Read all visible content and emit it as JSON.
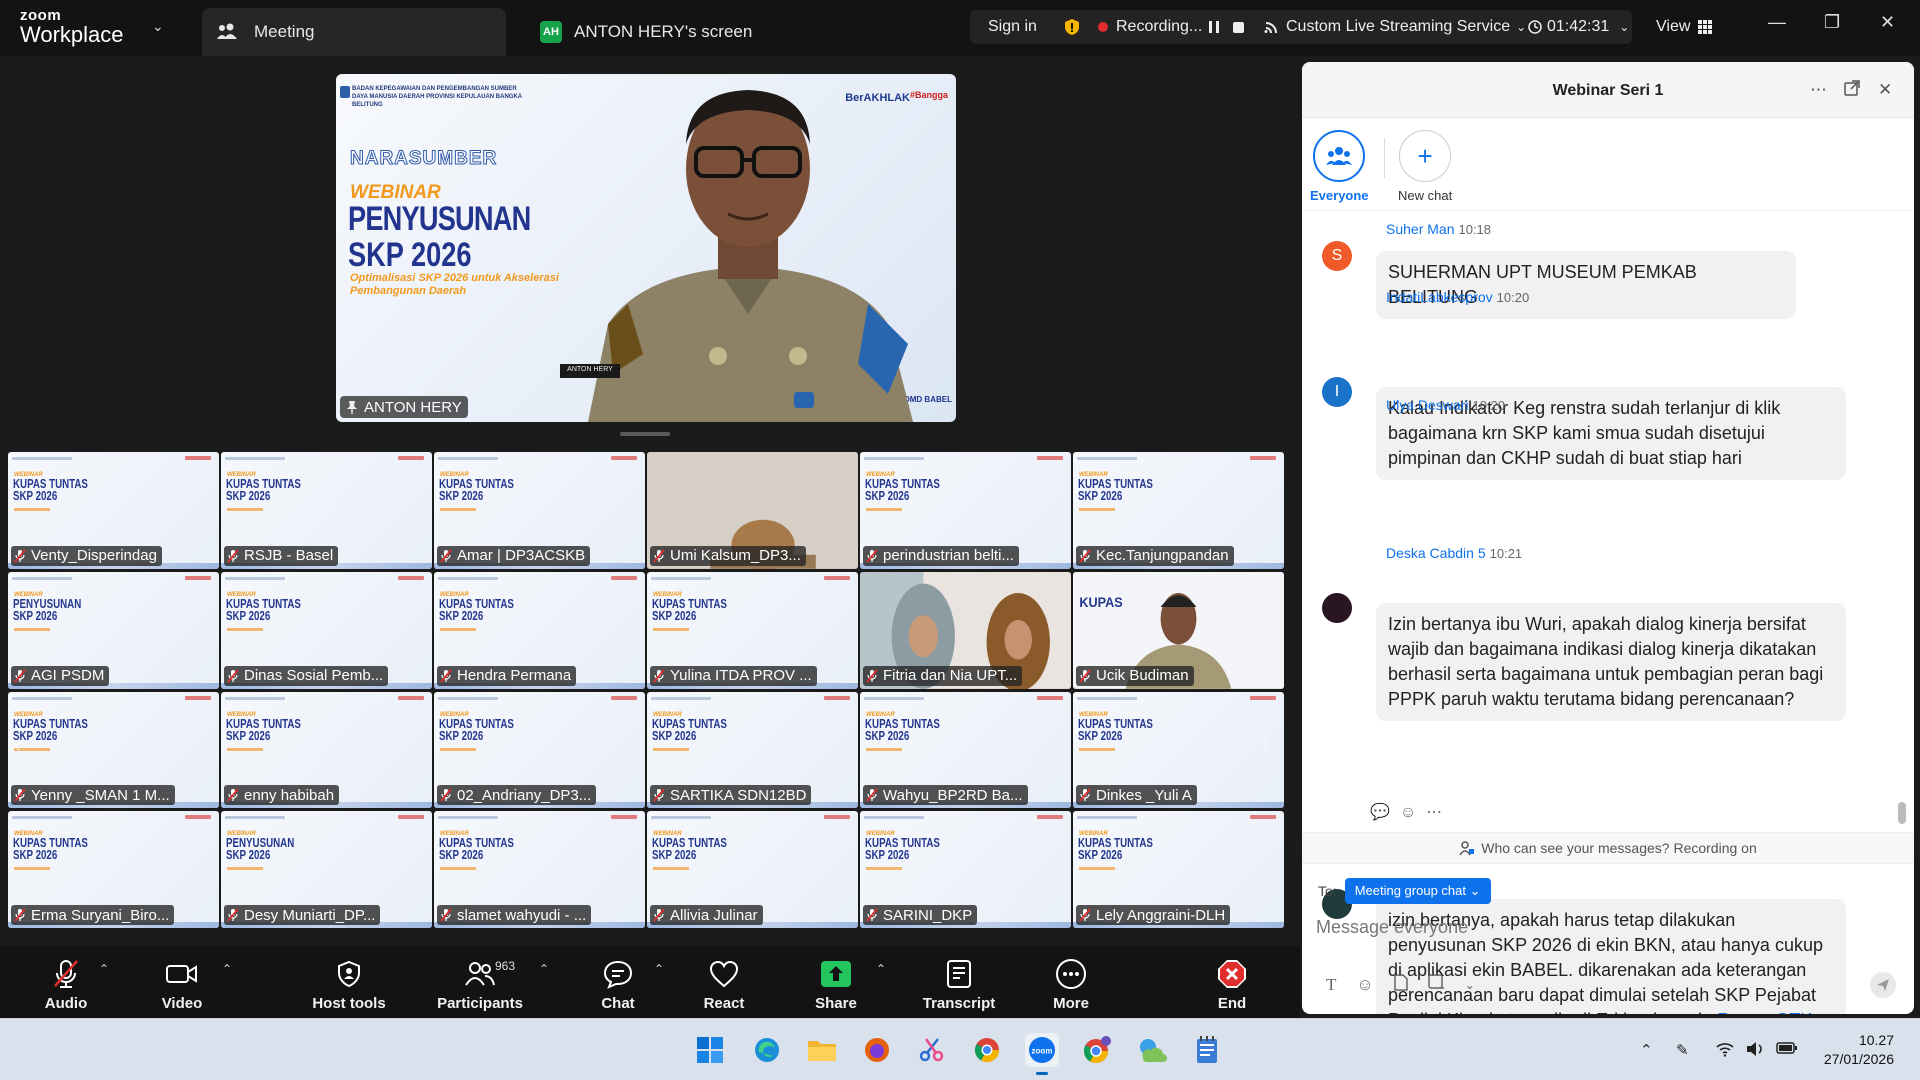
{
  "app": {
    "brand_line1": "zoom",
    "brand_line2": "Workplace",
    "tab_meeting": "Meeting",
    "tab_screen_badge": "AH",
    "tab_screen": "ANTON HERY's screen"
  },
  "titlebar": {
    "sign_in": "Sign in",
    "recording": "Recording...",
    "streaming": "Custom Live Streaming Service",
    "timer": "01:42:31",
    "view": "View"
  },
  "speaker": {
    "org_text": "BADAN KEPEGAWAIAN DAN PENGEMBANGAN SUMBER DAYA MANUSIA DAERAH PROVINSI KEPULAUAN BANGKA BELITUNG",
    "brand": "BerAKHLAK",
    "brand2": "#Bangga",
    "narasumber": "NARASUMBER",
    "webinar": "WEBINAR",
    "title_line1": "PENYUSUNAN",
    "title_line2": "SKP 2026",
    "subtitle": "Optimalisasi SKP 2026 untuk Akselerasi Pembangunan Daerah",
    "corner": "SDMD BABEL",
    "name": "ANTON HERY",
    "badge_text": "ANTON HERY"
  },
  "slide_mini": {
    "webinar": "WEBINAR",
    "kupas": "KUPAS TUNTAS SKP 2026",
    "penyusunan": "PENYUSUNAN SKP 2026"
  },
  "gallery": [
    {
      "name": "Venty_Disperindag",
      "kind": "slide"
    },
    {
      "name": "RSJB - Basel",
      "kind": "slide"
    },
    {
      "name": "Amar | DP3ACSKB",
      "kind": "slide"
    },
    {
      "name": "Umi Kalsum_DP3...",
      "kind": "cam"
    },
    {
      "name": "perindustrian belti...",
      "kind": "slide"
    },
    {
      "name": "Kec.Tanjungpandan",
      "kind": "slide"
    },
    {
      "name": "AGI PSDM",
      "kind": "slide2"
    },
    {
      "name": "Dinas Sosial Pemb...",
      "kind": "slide"
    },
    {
      "name": "Hendra Permana",
      "kind": "slide"
    },
    {
      "name": "Yulina ITDA PROV ...",
      "kind": "slide"
    },
    {
      "name": "Fitria dan Nia UPT...",
      "kind": "cam2"
    },
    {
      "name": "Ucik Budiman",
      "kind": "cam3"
    },
    {
      "name": "Yenny _SMAN 1 M...",
      "kind": "slide"
    },
    {
      "name": "enny habibah",
      "kind": "slide"
    },
    {
      "name": "02_Andriany_DP3...",
      "kind": "slide"
    },
    {
      "name": "SARTIKA SDN12BD",
      "kind": "slide"
    },
    {
      "name": "Wahyu_BP2RD Ba...",
      "kind": "slide"
    },
    {
      "name": "Dinkes _Yuli A",
      "kind": "slide"
    },
    {
      "name": "Erma Suryani_Biro...",
      "kind": "slide"
    },
    {
      "name": "Desy Muniarti_DP...",
      "kind": "slide2"
    },
    {
      "name": "slamet wahyudi - ...",
      "kind": "slide"
    },
    {
      "name": "Allivia Julinar",
      "kind": "slide"
    },
    {
      "name": "SARINI_DKP",
      "kind": "slide"
    },
    {
      "name": "Lely Anggraini-DLH",
      "kind": "slide"
    }
  ],
  "toolbar": {
    "audio": "Audio",
    "video": "Video",
    "host_tools": "Host tools",
    "participants": "Participants",
    "participants_count": "963",
    "chat": "Chat",
    "react": "React",
    "share": "Share",
    "transcript": "Transcript",
    "more": "More",
    "end": "End"
  },
  "chat": {
    "title": "Webinar Seri 1",
    "channel_everyone": "Everyone",
    "channel_new": "New chat",
    "messages": [
      {
        "sender": "Suher Man",
        "time": "10:18",
        "avatar": "S",
        "avatar_color": "#f05a28",
        "text": "SUHERMAN UPT MUSEUM PEMKAB BELITUNG"
      },
      {
        "sender": "IndatiLabkesprov",
        "time": "10:20",
        "avatar": "I",
        "avatar_color": "#1a73c9",
        "text": "Kalau Indikator Keg renstra sudah terlanjur di klik bagaimana krn SKP kami smua sudah disetujui pimpinan dan CKHP sudah di buat stiap hari"
      },
      {
        "sender": "Ulya Deswari",
        "time": "10:20",
        "avatar": "",
        "avatar_color": "#2a1522",
        "text": "Izin bertanya ibu Wuri, apakah dialog kinerja bersifat wajib dan bagaimana indikasi dialog kinerja dikatakan berhasil serta bagaimana untuk pembagian peran bagi PPPK paruh waktu terutama bidang perencanaan?"
      },
      {
        "sender": "Deska Cabdin 5",
        "time": "10:21",
        "avatar": "",
        "avatar_color": "#1f3a3a",
        "text": "izin bertanya, apakah harus tetap dilakukan penyusunan SKP 2026 di ekin BKN, atau hanya cukup di aplikasi ekin BABEL. dikarenakan ada keterangan perencanaan baru dapat dimulai setelah SKP Pejabat Penilai Kinerja tersedia di E-kinerja pada",
        "link": "Ruang GTK"
      }
    ],
    "notice": "Who can see your messages? Recording on",
    "to_label": "To:",
    "to_target": "Meeting group chat",
    "input_placeholder": "Message everyone"
  },
  "taskbar": {
    "time": "10.27",
    "date": "27/01/2026"
  },
  "colors": {
    "zoom_blue": "#0e72ed",
    "record_red": "#e02d2d",
    "share_green": "#22c55e",
    "end_red": "#e02d2d"
  }
}
